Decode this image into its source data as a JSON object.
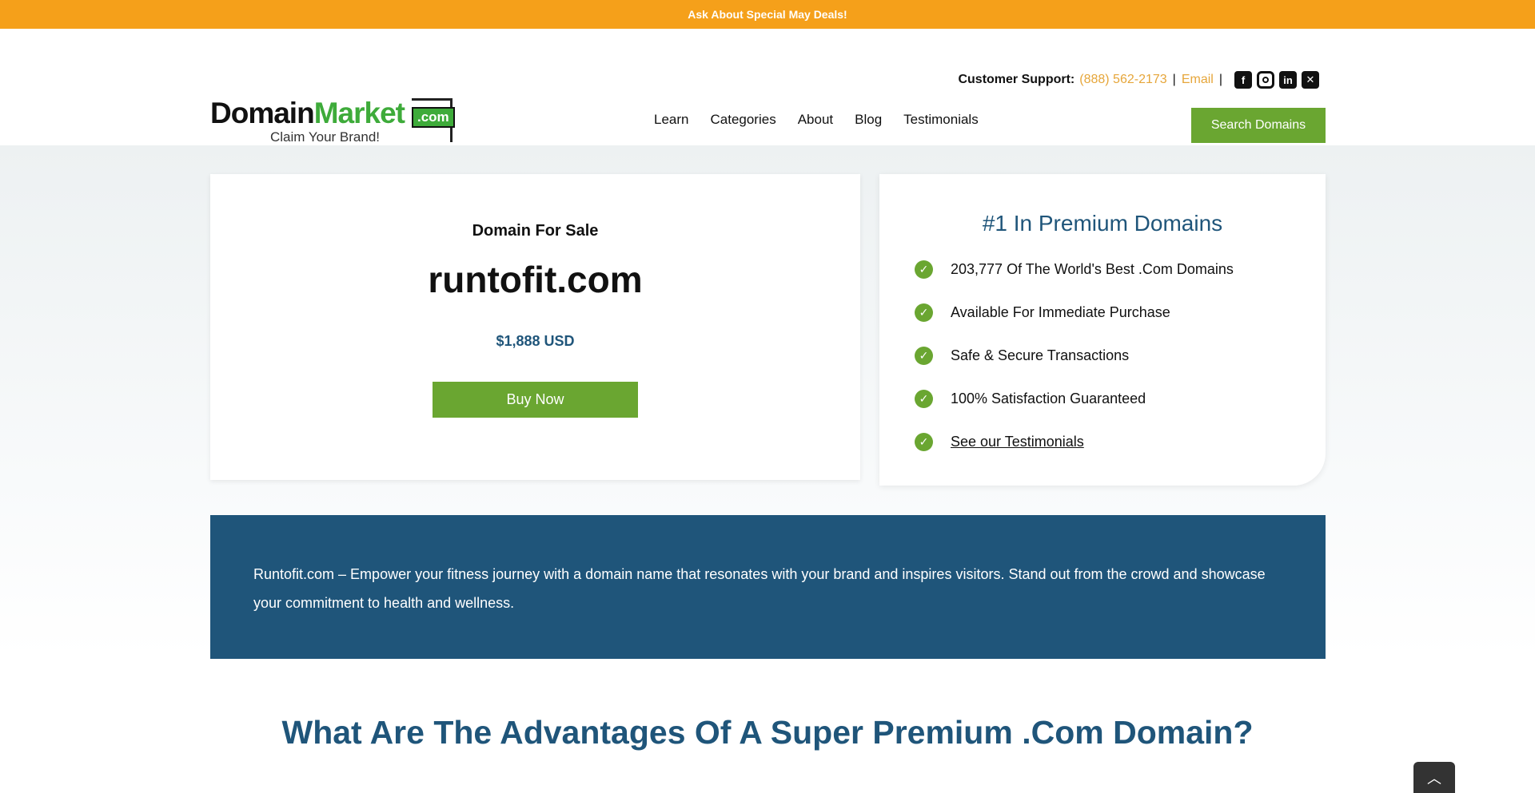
{
  "topbar": {
    "text": "Ask About Special May Deals!"
  },
  "header": {
    "support_label": "Customer Support:",
    "phone": "(888) 562-2173",
    "separator": "|",
    "email": "Email",
    "social": [
      "facebook-icon",
      "instagram-icon",
      "linkedin-icon",
      "x-twitter-icon"
    ],
    "logo": {
      "domain": "Domain",
      "market": "Market",
      "tld": ".com",
      "tagline": "Claim Your Brand!"
    },
    "nav": [
      "Learn",
      "Categories",
      "About",
      "Blog",
      "Testimonials"
    ],
    "search_button": "Search Domains"
  },
  "listing": {
    "subtitle": "Domain For Sale",
    "domain": "runtofit.com",
    "price": "$1,888 USD",
    "buy_button": "Buy Now"
  },
  "benefits": {
    "title": "#1 In Premium Domains",
    "items": [
      "203,777 Of The World's Best .Com Domains",
      "Available For Immediate Purchase",
      "Safe & Secure Transactions",
      "100% Satisfaction Guaranteed",
      "See our Testimonials"
    ]
  },
  "description": "Runtofit.com – Empower your fitness journey with a domain name that resonates with your brand and inspires visitors. Stand out from the crowd and showcase your commitment to health and wellness.",
  "advantages_title": "What Are The Advantages Of A Super Premium .Com Domain?",
  "colors": {
    "accent_orange": "#f5a01a",
    "brand_green": "#6aa631",
    "brand_blue": "#1f557a"
  }
}
